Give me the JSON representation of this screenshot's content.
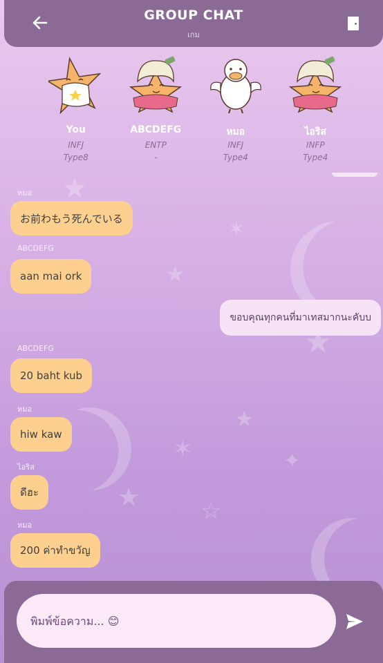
{
  "header": {
    "title": "GROUP CHAT",
    "subtitle": "เกม",
    "back_icon": "arrow-left-icon",
    "exit_icon": "door-exit-icon"
  },
  "members": [
    {
      "name": "You",
      "mbti": "INFJ",
      "enneagram": "Type8",
      "avatar": "star-with-shirt"
    },
    {
      "name": "ABCDEFG",
      "mbti": "ENTP",
      "enneagram": "-",
      "avatar": "star-with-hair"
    },
    {
      "name": "หมอ",
      "mbti": "INFJ",
      "enneagram": "Type4",
      "avatar": "white-bird"
    },
    {
      "name": "ไอริส",
      "mbti": "INFP",
      "enneagram": "Type4",
      "avatar": "star-with-hair"
    }
  ],
  "messages": [
    {
      "sender": "หมอ",
      "text": "お前わもう死んでいる",
      "direction": "in"
    },
    {
      "sender": "ABCDEFG",
      "text": "aan mai ork",
      "direction": "in"
    },
    {
      "sender": "",
      "text": "ขอบคุณทุกคนที่มาเทสมากนะคับบ",
      "direction": "out"
    },
    {
      "sender": "ABCDEFG",
      "text": "20 baht kub",
      "direction": "in"
    },
    {
      "sender": "หมอ",
      "text": "hiw kaw",
      "direction": "in"
    },
    {
      "sender": "ไอริส",
      "text": "ดีฮะ",
      "direction": "in"
    },
    {
      "sender": "หมอ",
      "text": "200 ค่าทำขวัญ",
      "direction": "in"
    }
  ],
  "composer": {
    "placeholder": "พิมพ์ข้อความ... 😊",
    "send_icon": "send-icon"
  },
  "colors": {
    "header": "#8c6a96",
    "incoming_bubble": "#fdd090",
    "outgoing_bubble": "#f6e4f6",
    "input_background": "#fbe9f7"
  }
}
